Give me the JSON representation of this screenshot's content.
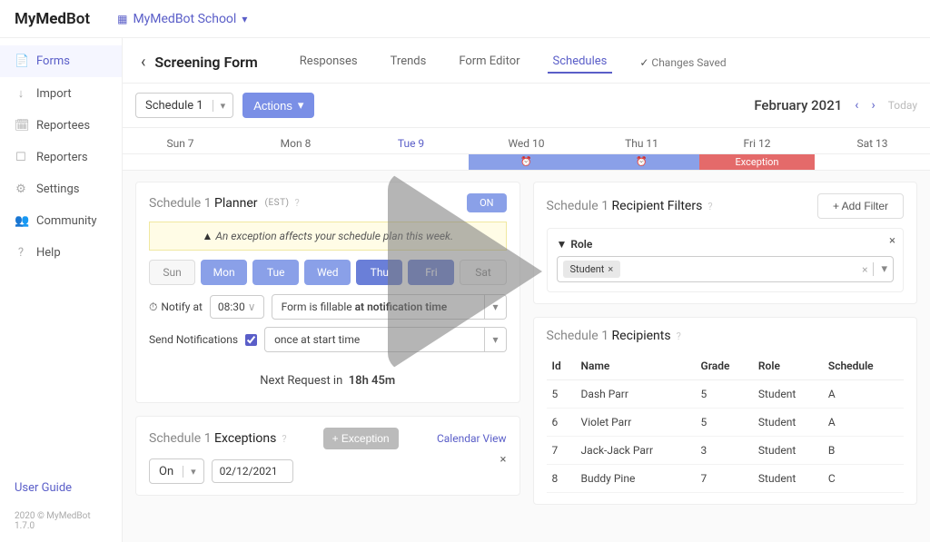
{
  "logo": {
    "part1": "My",
    "part2": "Med",
    "part3": "Bot"
  },
  "school_selector": "MyMedBot School",
  "sidebar": {
    "items": [
      {
        "label": "Forms",
        "icon": "📄"
      },
      {
        "label": "Import",
        "icon": "↓"
      },
      {
        "label": "Reportees",
        "icon": "🗓"
      },
      {
        "label": "Reporters",
        "icon": "☐"
      },
      {
        "label": "Settings",
        "icon": "⚙"
      },
      {
        "label": "Community",
        "icon": "👥"
      },
      {
        "label": "Help",
        "icon": "?"
      }
    ],
    "user_guide": "User Guide",
    "copyright": "2020 © MyMedBot 1.7.0"
  },
  "header": {
    "title": "Screening Form",
    "tabs": [
      "Responses",
      "Trends",
      "Form Editor",
      "Schedules"
    ],
    "saved": "Changes Saved"
  },
  "schedule_select": "Schedule 1",
  "actions_btn": "Actions",
  "month": "February 2021",
  "today": "Today",
  "calendar": {
    "days": [
      "Sun 7",
      "Mon 8",
      "Tue 9",
      "Wed 10",
      "Thu 11",
      "Fri 12",
      "Sat 13"
    ],
    "exception_label": "Exception"
  },
  "planner": {
    "prefix": "Schedule 1",
    "title": "Planner",
    "tz": "(EST)",
    "toggle": "ON",
    "warning": "An exception affects your schedule plan this week.",
    "days": [
      "Sun",
      "Mon",
      "Tue",
      "Wed",
      "Thu",
      "Fri",
      "Sat"
    ],
    "notify_label": "Notify at",
    "notify_time": "08:30",
    "fillable_text": "Form is fillable ",
    "fillable_bold": "at notification time",
    "send_label": "Send Notifications",
    "send_option": "once at start time",
    "next_prefix": "Next Request in",
    "next_value": "18h 45m"
  },
  "exceptions": {
    "prefix": "Schedule 1",
    "title": "Exceptions",
    "add_btn": "+ Exception",
    "calendar_link": "Calendar View",
    "on_label": "On",
    "date": "02/12/2021"
  },
  "filters": {
    "prefix": "Schedule 1",
    "title": "Recipient Filters",
    "add_btn": "+ Add Filter",
    "role_label": "Role",
    "tag": "Student"
  },
  "recipients": {
    "prefix": "Schedule 1",
    "title": "Recipients",
    "headers": [
      "Id",
      "Name",
      "Grade",
      "Role",
      "Schedule"
    ],
    "rows": [
      {
        "id": "5",
        "name": "Dash Parr",
        "grade": "5",
        "role": "Student",
        "schedule": "A"
      },
      {
        "id": "6",
        "name": "Violet Parr",
        "grade": "5",
        "role": "Student",
        "schedule": "A"
      },
      {
        "id": "7",
        "name": "Jack-Jack Parr",
        "grade": "3",
        "role": "Student",
        "schedule": "B"
      },
      {
        "id": "8",
        "name": "Buddy Pine",
        "grade": "7",
        "role": "Student",
        "schedule": "C"
      }
    ]
  }
}
